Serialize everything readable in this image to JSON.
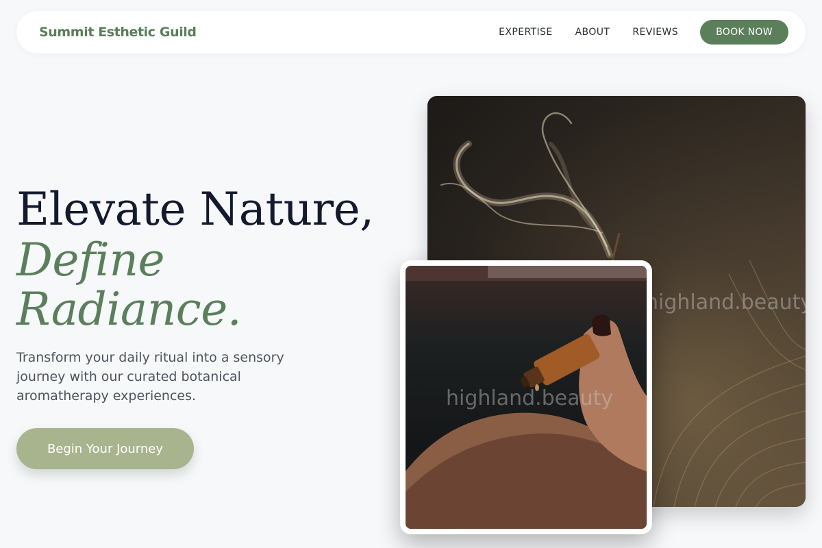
{
  "nav": {
    "brand": "Summit Esthetic Guild",
    "links": [
      "EXPERTISE",
      "ABOUT",
      "REVIEWS"
    ],
    "book_label": "BOOK NOW"
  },
  "hero": {
    "headline_1": "Elevate Nature,",
    "headline_2": "Define Radiance.",
    "subtext": "Transform your daily ritual into a sensory journey with our curated botanical aromatherapy experiences.",
    "cta_label": "Begin Your Journey"
  },
  "images": {
    "watermark_back": "highland.beauty",
    "watermark_front": "highland.beauty"
  },
  "colors": {
    "accent": "#5b7f5b",
    "cta": "#a7b48d",
    "headline": "#141a2e",
    "background": "#f6f8fa"
  }
}
